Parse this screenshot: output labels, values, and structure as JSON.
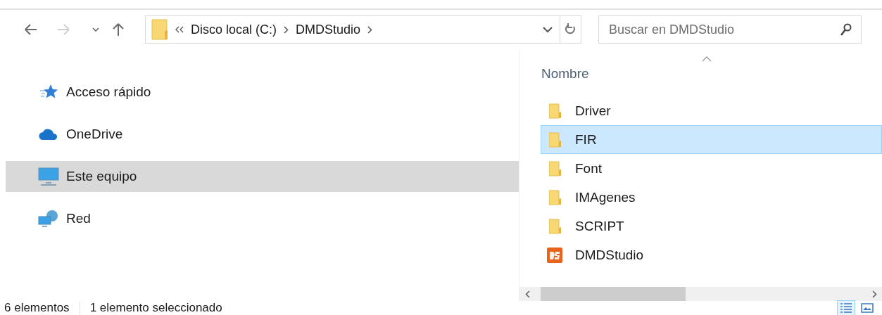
{
  "navigation": [
    {
      "kind": "back",
      "disabled": false
    },
    {
      "kind": "forward",
      "disabled": true
    },
    {
      "kind": "recent",
      "disabled": false
    },
    {
      "kind": "up",
      "disabled": false
    }
  ],
  "address": {
    "segments": [
      "Disco local (C:)",
      "DMDStudio"
    ]
  },
  "search": {
    "placeholder": "Buscar en DMDStudio"
  },
  "sidebar": {
    "items": [
      {
        "label": "Acceso rápido",
        "kind": "quick",
        "selected": false
      },
      {
        "label": "OneDrive",
        "kind": "cloud",
        "selected": false
      },
      {
        "label": "Este equipo",
        "kind": "computer",
        "selected": true
      },
      {
        "label": "Red",
        "kind": "network",
        "selected": false
      }
    ]
  },
  "files": {
    "columns": [
      {
        "label": "Nombre",
        "sorted_ascending": true
      }
    ],
    "rows": [
      {
        "name": "Driver",
        "kind": "folder",
        "selected": false
      },
      {
        "name": "FIR",
        "kind": "folder",
        "selected": true
      },
      {
        "name": "Font",
        "kind": "folder",
        "selected": false
      },
      {
        "name": "IMAgenes",
        "kind": "folder",
        "selected": false
      },
      {
        "name": "SCRIPT",
        "kind": "folder",
        "selected": false
      },
      {
        "name": "DMDStudio",
        "kind": "app",
        "selected": false
      }
    ]
  },
  "status_bar": {
    "count": "6 elementos",
    "selection": "1 elemento seleccionado",
    "views": [
      {
        "kind": "details",
        "selected": true
      },
      {
        "kind": "tiles",
        "selected": false
      }
    ]
  }
}
